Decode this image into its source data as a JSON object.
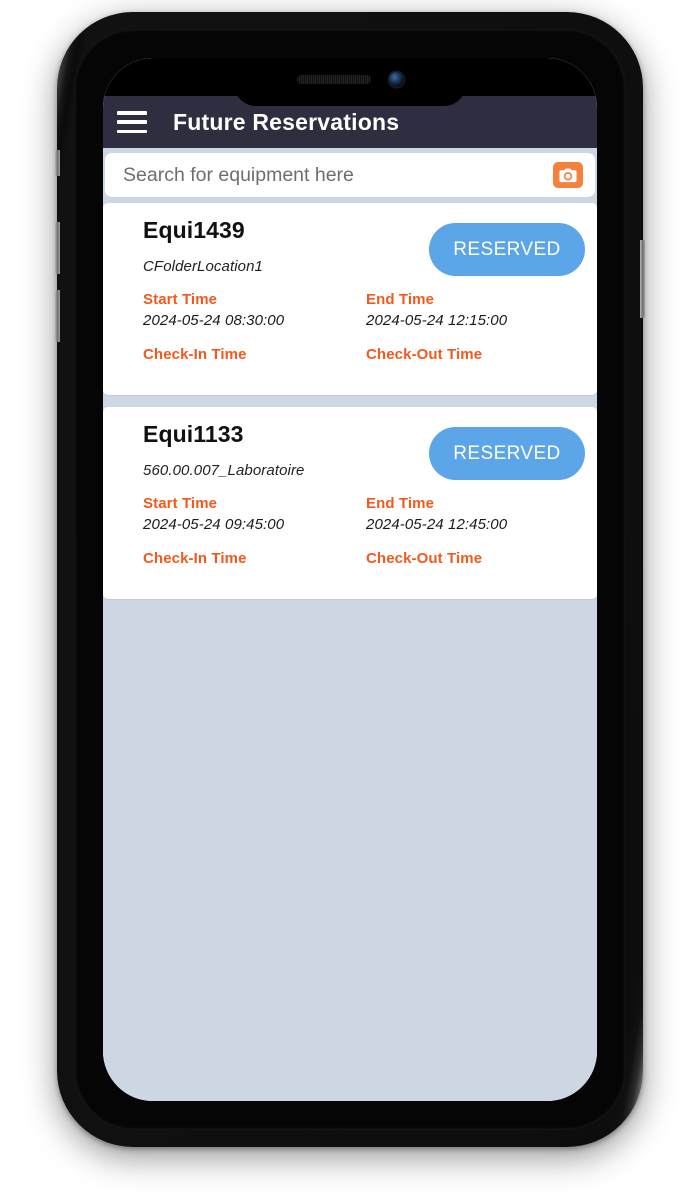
{
  "app_bar": {
    "menu_icon": "hamburger-menu-icon",
    "title": "Future Reservations",
    "background_color": "#2e2e40"
  },
  "search": {
    "placeholder": "Search for equipment here",
    "value": "",
    "camera_icon": "camera-icon",
    "camera_button_color": "#f5823c"
  },
  "theme": {
    "page_background": "#cdd6e3",
    "card_background": "#ffffff",
    "label_accent": "#f4581c",
    "status_pill_color": "#5ca5e8"
  },
  "labels": {
    "start_time": "Start Time",
    "end_time": "End Time",
    "check_in_time": "Check-In Time",
    "check_out_time": "Check-Out Time"
  },
  "reservations": [
    {
      "equipment": "Equi1439",
      "location": "CFolderLocation1",
      "status": "RESERVED",
      "start_time": "2024-05-24 08:30:00",
      "end_time": "2024-05-24 12:15:00",
      "check_in_time": "",
      "check_out_time": ""
    },
    {
      "equipment": "Equi1133",
      "location": "560.00.007_Laboratoire",
      "status": "RESERVED",
      "start_time": "2024-05-24 09:45:00",
      "end_time": "2024-05-24 12:45:00",
      "check_in_time": "",
      "check_out_time": ""
    }
  ]
}
